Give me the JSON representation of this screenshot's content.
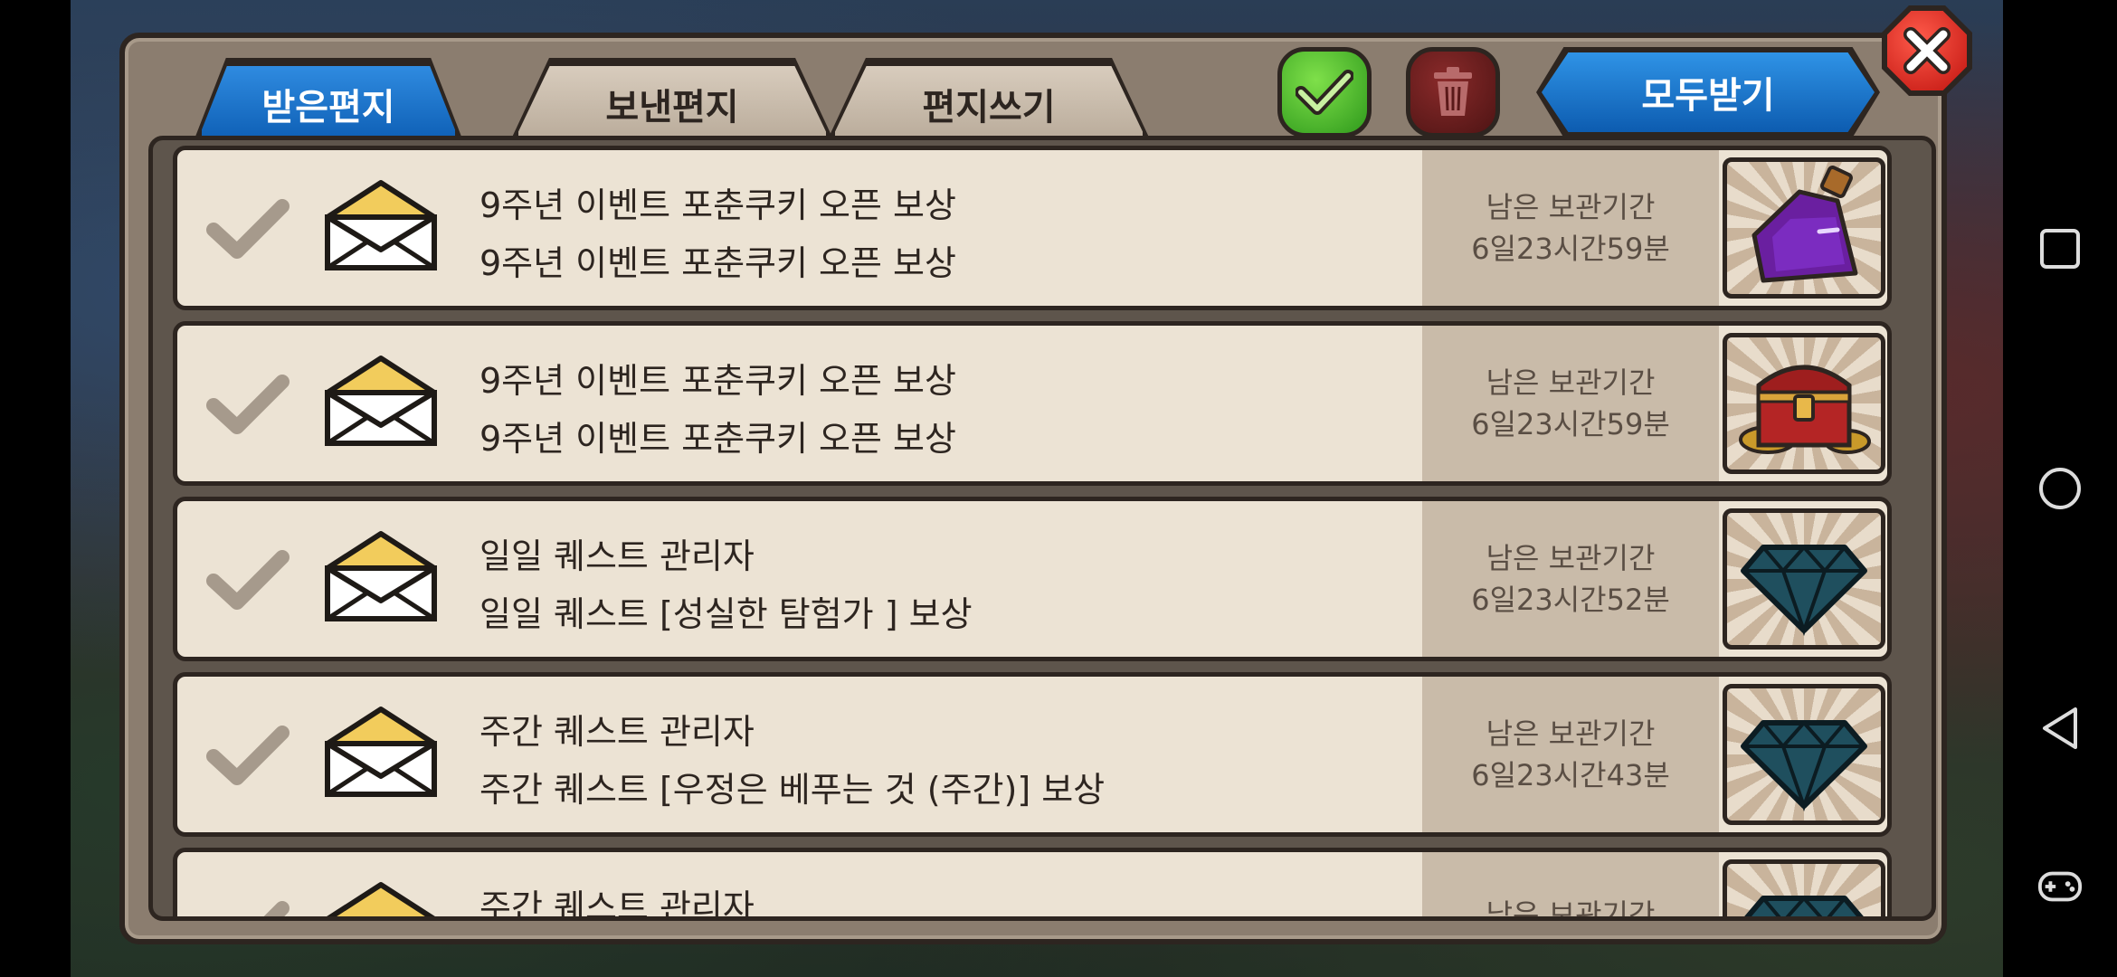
{
  "tabs": [
    {
      "label": "받은편지",
      "active": true
    },
    {
      "label": "보낸편지",
      "active": false
    },
    {
      "label": "편지쓰기",
      "active": false
    }
  ],
  "actions": {
    "receive_all_label": "모두받기",
    "check_icon": "check-icon",
    "trash_icon": "trash-icon",
    "close_icon": "close-icon"
  },
  "mails": [
    {
      "title": "9주년 이벤트 포춘쿠키 오픈 보상",
      "description": "9주년 이벤트 포춘쿠키 오픈 보상",
      "time_label": "남은 보관기간",
      "time_value": "6일23시간59분",
      "item": "potion"
    },
    {
      "title": "9주년 이벤트 포춘쿠키 오픈 보상",
      "description": "9주년 이벤트 포춘쿠키 오픈 보상",
      "time_label": "남은 보관기간",
      "time_value": "6일23시간59분",
      "item": "treasure-chest"
    },
    {
      "title": "일일 퀘스트 관리자",
      "description": "일일 퀘스트 [성실한 탐험가 ] 보상",
      "time_label": "남은 보관기간",
      "time_value": "6일23시간52분",
      "item": "diamond"
    },
    {
      "title": "주간 퀘스트 관리자",
      "description": "주간 퀘스트 [우정은 베푸는 것 (주간)] 보상",
      "time_label": "남은 보관기간",
      "time_value": "6일23시간43분",
      "item": "diamond"
    },
    {
      "title": "주간 퀘스트 관리자",
      "description": "",
      "time_label": "남은 보관기간",
      "time_value": "",
      "item": "diamond"
    }
  ],
  "colors": {
    "tab_active": "#1a72cc",
    "panel": "#8b7d6f",
    "row_bg": "#ece3d4",
    "outline": "#2d2520"
  }
}
